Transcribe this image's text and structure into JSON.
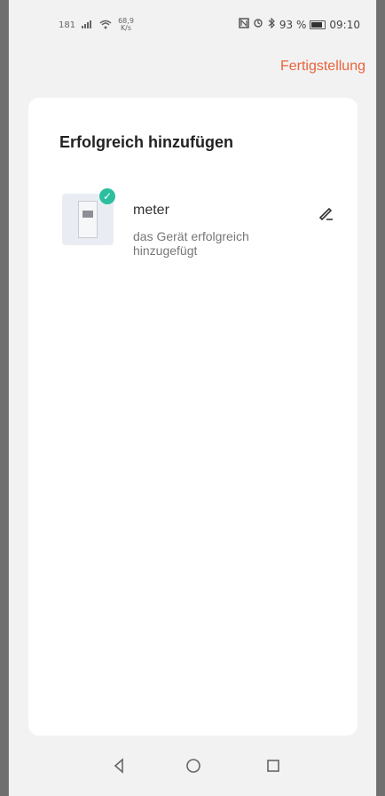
{
  "status_bar": {
    "left_text": "181",
    "speed_value": "68,9",
    "speed_unit": "K/s",
    "battery": "93 %",
    "time": "09:10"
  },
  "header": {
    "done_label": "Fertigstellung"
  },
  "card": {
    "title": "Erfolgreich hinzufügen",
    "device": {
      "name": "meter",
      "status": "das Gerät erfolgreich hinzugefügt"
    }
  },
  "icons": {
    "check": "check-icon",
    "edit": "pencil-icon",
    "nav_back": "triangle-back-icon",
    "nav_home": "circle-home-icon",
    "nav_recent": "square-recent-icon"
  },
  "colors": {
    "accent": "#e8643b",
    "success": "#2bbf9f"
  }
}
